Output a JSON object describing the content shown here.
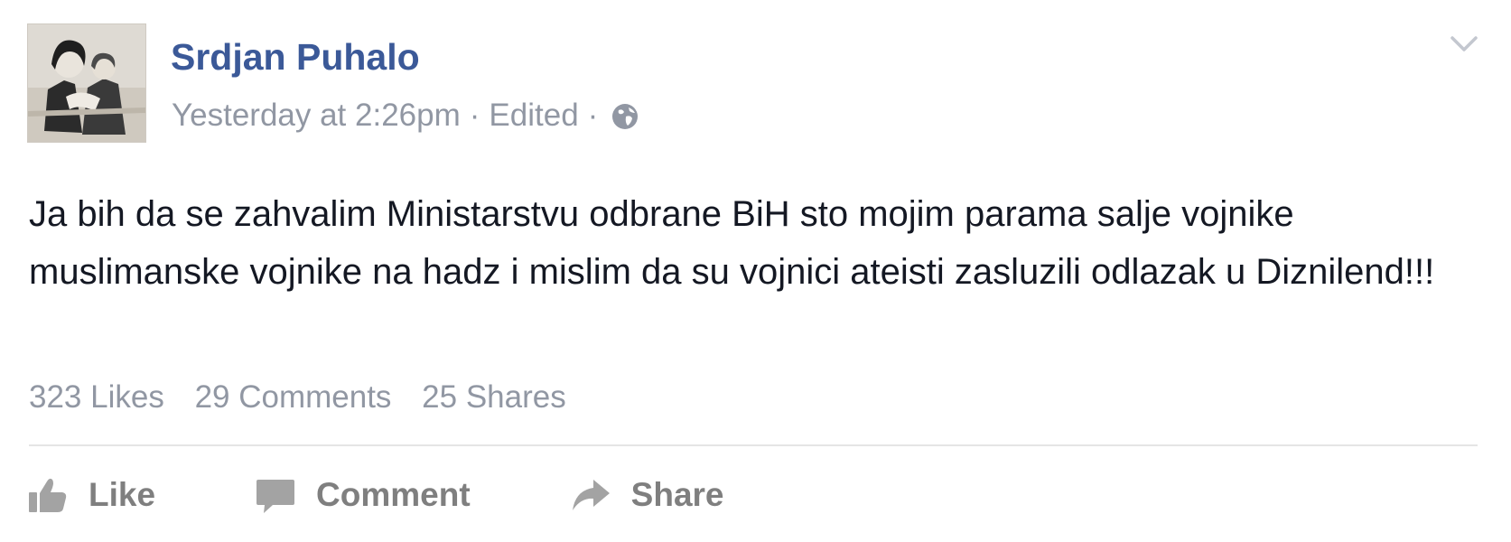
{
  "post": {
    "author_name": "Srdjan Puhalo",
    "timestamp": "Yesterday at 2:26pm",
    "separator": "·",
    "edited_label": "Edited",
    "privacy_icon": "globe-icon",
    "options_icon": "chevron-down-icon",
    "text": "Ja bih da se zahvalim Ministarstvu odbrane BiH sto mojim parama salje vojnike muslimanske vojnike na hadz i mislim da su vojnici ateisti zasluzili odlazak u Diznilend!!!"
  },
  "stats": {
    "likes": "323 Likes",
    "comments": "29 Comments",
    "shares": "25 Shares"
  },
  "actions": [
    {
      "label": "Like",
      "icon": "thumbs-up-icon"
    },
    {
      "label": "Comment",
      "icon": "comment-bubble-icon"
    },
    {
      "label": "Share",
      "icon": "share-arrow-icon"
    }
  ],
  "colors": {
    "author_link": "#3b5998",
    "meta_text": "#9197a3",
    "body_text": "#141823",
    "action_text": "#7f7f7f",
    "action_icon": "#a3a3a3",
    "divider": "#e5e5e5"
  }
}
